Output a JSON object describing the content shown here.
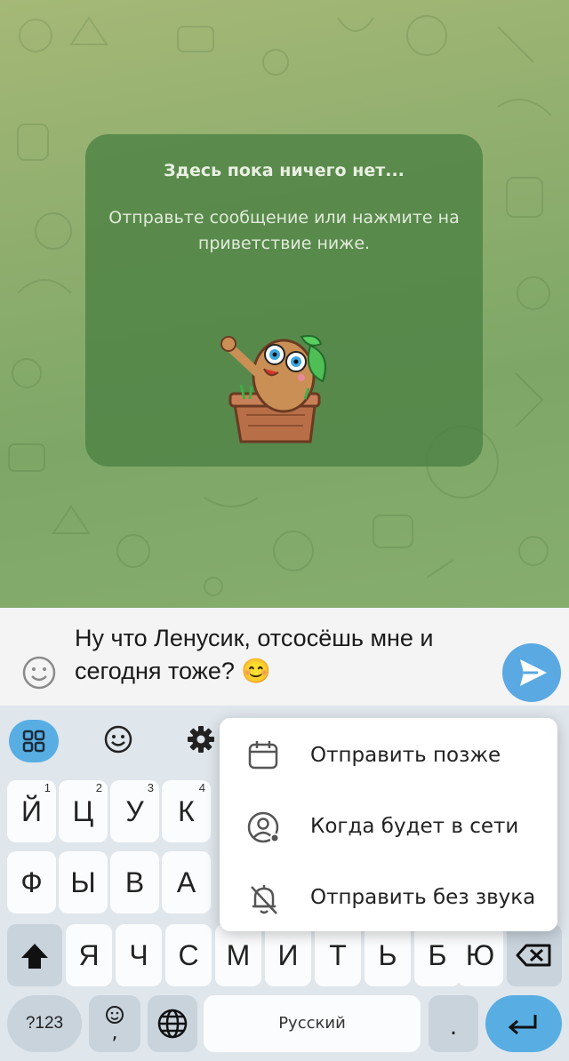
{
  "empty_chat": {
    "title": "Здесь пока ничего нет...",
    "subtitle": "Отправьте сообщение или нажмите на приветствие ниже."
  },
  "compose": {
    "message_line1": "Ну что Ленусик, отсосёшь мне и",
    "message_line2": "сегодня тоже?",
    "message_emoji": "😊"
  },
  "send_menu": {
    "items": [
      {
        "label": "Отправить позже",
        "icon": "calendar-icon"
      },
      {
        "label": "Когда будет в сети",
        "icon": "user-online-icon"
      },
      {
        "label": "Отправить без звука",
        "icon": "bell-off-icon"
      }
    ]
  },
  "keyboard": {
    "row1": [
      {
        "key": "Й",
        "num": "1"
      },
      {
        "key": "Ц",
        "num": "2"
      },
      {
        "key": "У",
        "num": "3"
      },
      {
        "key": "К",
        "num": "4"
      }
    ],
    "row2": [
      "Ф",
      "Ы",
      "В",
      "А"
    ],
    "row3": [
      "Я",
      "Ч",
      "С",
      "М",
      "И",
      "Т",
      "Ь",
      "Б",
      "Ю"
    ],
    "symbols_label": "?123",
    "space_label": "Русский",
    "dot_label": ".",
    "emoji_key_sub": ","
  },
  "colors": {
    "accent": "#58aee3",
    "send_button": "#5aa9e2",
    "chat_bg": "#8fae6e",
    "card_bg": "#4a8042"
  }
}
